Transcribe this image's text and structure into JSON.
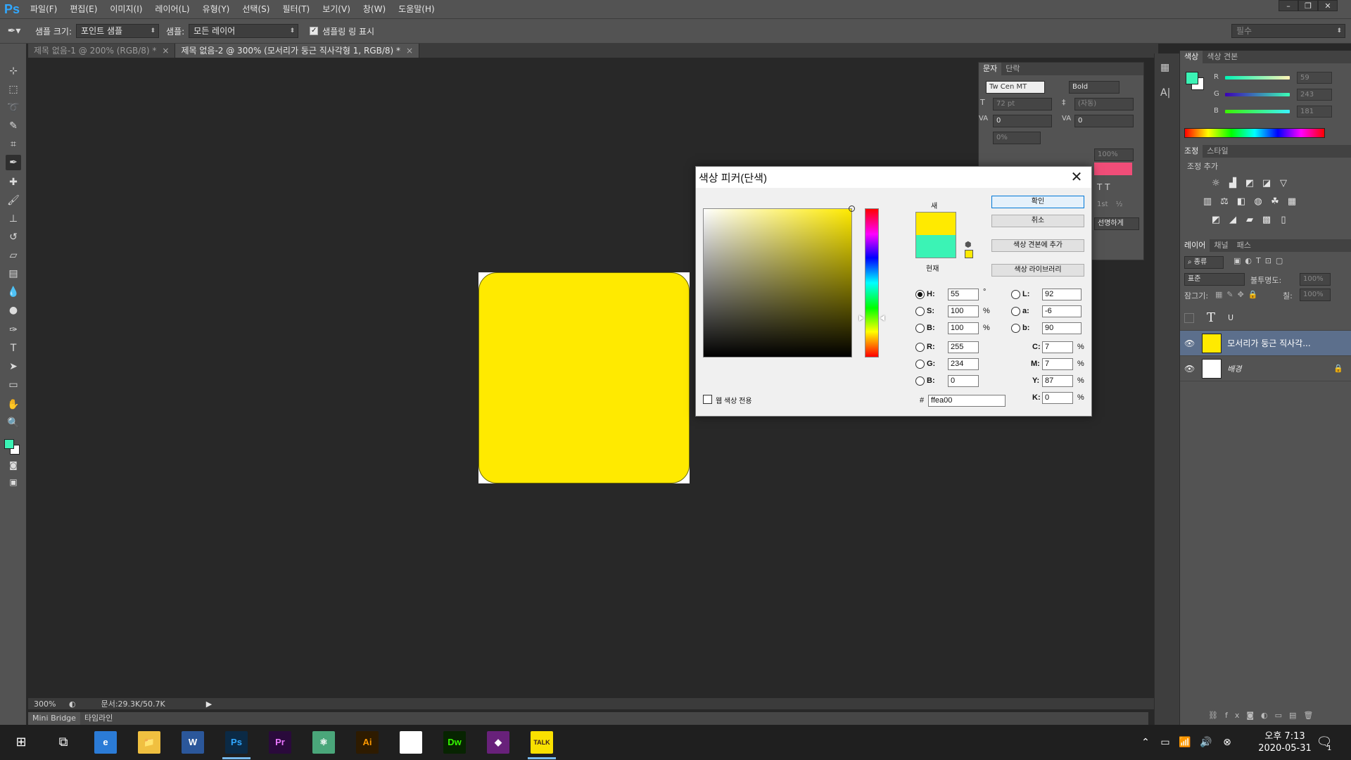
{
  "app": {
    "logo": "Ps",
    "menu": [
      "파일(F)",
      "편집(E)",
      "이미지(I)",
      "레이어(L)",
      "유형(Y)",
      "선택(S)",
      "필터(T)",
      "보기(V)",
      "창(W)",
      "도움말(H)"
    ],
    "window_controls": [
      "–",
      "❐",
      "✕"
    ]
  },
  "options_bar": {
    "sample_size_label": "샘플 크기:",
    "sample_size_value": "포인트 샘플",
    "sample_label": "샘플:",
    "sample_value": "모든 레이어",
    "show_ring_label": "샘플링 링 표시",
    "show_ring_checked": true,
    "workspace_value": "필수"
  },
  "doc_tabs": [
    {
      "label": "제목 없음-1 @ 200% (RGB/8) *",
      "active": false
    },
    {
      "label": "제목 없음-2 @ 300% (모서리가 둥근 직사각형 1, RGB/8) *",
      "active": true
    }
  ],
  "canvas": {
    "shape_color": "#ffea00",
    "background_color": "#ffffff"
  },
  "status": {
    "zoom": "300%",
    "doc_size": "문서:29.3K/50.7K"
  },
  "bottom_tabs": [
    "Mini Bridge",
    "타임라인"
  ],
  "character_panel": {
    "tabs": [
      "문자",
      "단락"
    ],
    "font_family": "Tw Cen MT",
    "font_style": "Bold",
    "font_size": "72 pt",
    "leading": "(자동)",
    "kerning": "0",
    "tracking": "0",
    "vertical_scale": "0%",
    "horizontal_scale": "100%",
    "color_swatch": "#f04d78",
    "anti_alias": "선명하게",
    "ordinal": "1st",
    "fraction": "½"
  },
  "color_panel": {
    "tabs": [
      "색상",
      "색상 견본"
    ],
    "foreground": "#3bf3b5",
    "background": "#ffffff",
    "r_label": "R",
    "g_label": "G",
    "b_label": "B",
    "r_value": "59",
    "g_value": "243",
    "b_value": "181"
  },
  "adjustments_panel": {
    "tabs": [
      "조정",
      "스타일"
    ],
    "add_label": "조정 추가"
  },
  "layers_panel": {
    "tabs": [
      "레이어",
      "채널",
      "패스"
    ],
    "filter_label": "종류",
    "blend_mode": "표준",
    "opacity_label": "불투명도:",
    "opacity_value": "100%",
    "lock_label": "잠그기:",
    "fill_label": "칠:",
    "fill_value": "100%",
    "layers": [
      {
        "name": "U",
        "kind": "text",
        "visible": false,
        "selected": false
      },
      {
        "name": "모서리가 둥근 직사각...",
        "kind": "shape",
        "visible": true,
        "selected": true,
        "thumb": "#ffea00"
      },
      {
        "name": "배경",
        "kind": "background",
        "visible": true,
        "selected": false,
        "locked": true,
        "thumb": "#ffffff"
      }
    ]
  },
  "color_picker": {
    "title": "색상 피커(단색)",
    "new_label": "새",
    "current_label": "현재",
    "new_color": "#ffea00",
    "current_color": "#3bf3b5",
    "buttons": {
      "ok": "확인",
      "cancel": "취소",
      "add_swatch": "색상 견본에 추가",
      "libraries": "색상 라이브러리"
    },
    "web_only_label": "웹 색상 전용",
    "hsb": {
      "H_label": "H:",
      "H": "55",
      "H_unit": "°",
      "S_label": "S:",
      "S": "100",
      "S_unit": "%",
      "B_label": "B:",
      "B": "100",
      "B_unit": "%"
    },
    "rgb": {
      "R_label": "R:",
      "R": "255",
      "G_label": "G:",
      "G": "234",
      "B_label": "B:",
      "B": "0"
    },
    "lab": {
      "L_label": "L:",
      "L": "92",
      "a_label": "a:",
      "a": "-6",
      "b_label": "b:",
      "b": "90"
    },
    "cmyk": {
      "C_label": "C:",
      "C": "7",
      "M_label": "M:",
      "M": "7",
      "Y_label": "Y:",
      "Y": "87",
      "K_label": "K:",
      "K": "0",
      "unit": "%"
    },
    "hex_label": "#",
    "hex": "ffea00"
  },
  "taskbar": {
    "time": "오후 7:13",
    "date": "2020-05-31",
    "notification_count": "1",
    "apps": [
      {
        "name": "edge",
        "label": "e",
        "color": "#2b7bd6"
      },
      {
        "name": "explorer",
        "label": "📁",
        "color": "#f0c040"
      },
      {
        "name": "word",
        "label": "W",
        "color": "#2b579a"
      },
      {
        "name": "photoshop",
        "label": "Ps",
        "color": "#0b2a45",
        "fg": "#31a8ff",
        "active": true
      },
      {
        "name": "premiere",
        "label": "Pr",
        "color": "#2a0a3b",
        "fg": "#ea77ff"
      },
      {
        "name": "atom",
        "label": "⚛",
        "color": "#4aa67a"
      },
      {
        "name": "illustrator",
        "label": "Ai",
        "color": "#2e1b00",
        "fg": "#ff9a00"
      },
      {
        "name": "chrome",
        "label": "◉",
        "color": "#ffffff"
      },
      {
        "name": "dreamweaver",
        "label": "Dw",
        "color": "#072401",
        "fg": "#35fa00"
      },
      {
        "name": "visual-studio",
        "label": "◆",
        "color": "#68217a"
      },
      {
        "name": "kakaotalk",
        "label": "TALK",
        "color": "#f9e000",
        "fg": "#3a1d1d",
        "active": true
      }
    ]
  }
}
